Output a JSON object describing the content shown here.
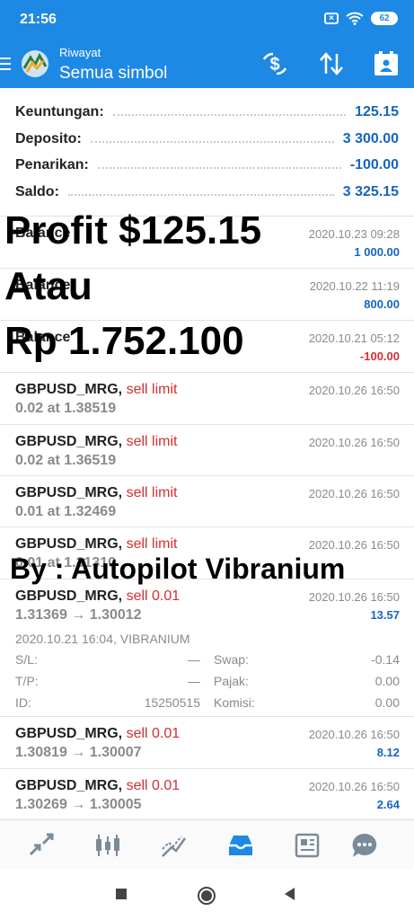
{
  "status_bar": {
    "time": "21:56",
    "close_badge": "×",
    "battery": "62"
  },
  "app_bar": {
    "subtitle": "Riwayat",
    "title": "Semua simbol"
  },
  "summary": [
    {
      "label": "Keuntungan:",
      "value": "125.15"
    },
    {
      "label": "Deposito:",
      "value": "3 300.00"
    },
    {
      "label": "Penarikan:",
      "value": "-100.00"
    },
    {
      "label": "Saldo:",
      "value": "3 325.15"
    }
  ],
  "balance_rows": [
    {
      "label": "Balance",
      "time": "2020.10.23 09:28",
      "amount": "1 000.00"
    },
    {
      "label": "Balance",
      "time": "2020.10.22 11:19",
      "amount": "800.00"
    },
    {
      "label": "Balance",
      "time": "2020.10.21 05:12",
      "amount": "-100.00"
    }
  ],
  "orders": [
    {
      "symbol": "GBPUSD_MRG,",
      "type": "sell limit",
      "detail": "0.02 at 1.38519",
      "time": "2020.10.26 16:50"
    },
    {
      "symbol": "GBPUSD_MRG,",
      "type": "sell limit",
      "detail": "0.02 at 1.36519",
      "time": "2020.10.26 16:50"
    },
    {
      "symbol": "GBPUSD_MRG,",
      "type": "sell limit",
      "detail": "0.01 at 1.32469",
      "time": "2020.10.26 16:50"
    },
    {
      "symbol": "GBPUSD_MRG,",
      "type": "sell limit",
      "detail": "0.01 at 1.31310",
      "time": "2020.10.26 16:50"
    }
  ],
  "expanded_deal": {
    "symbol": "GBPUSD_MRG,",
    "type": "sell 0.01",
    "prices": "1.31369 → 1.30012",
    "time": "2020.10.26 16:50",
    "profit": "13.57",
    "open_info": "2020.10.21 16:04, VIBRANIUM",
    "sl_label": "S/L:",
    "sl_value": "—",
    "tp_label": "T/P:",
    "tp_value": "—",
    "id_label": "ID:",
    "id_value": "15250515",
    "swap_label": "Swap:",
    "swap_value": "-0.14",
    "tax_label": "Pajak:",
    "tax_value": "0.00",
    "commission_label": "Komisi:",
    "commission_value": "0.00"
  },
  "deals": [
    {
      "symbol": "GBPUSD_MRG,",
      "type": "sell 0.01",
      "prices": "1.30819 → 1.30007",
      "time": "2020.10.26 16:50",
      "profit": "8.12"
    },
    {
      "symbol": "GBPUSD_MRG,",
      "type": "sell 0.01",
      "prices": "1.30269 → 1.30005",
      "time": "2020.10.26 16:50",
      "profit": "2.64"
    }
  ],
  "overlay_text": {
    "line1": "Profit $125.15",
    "line2": "Atau",
    "line3": "Rp 1.752.100",
    "credit": "By : Autopilot Vibranium"
  },
  "tabs": [
    "quotes-icon",
    "chart-icon",
    "trade-icon",
    "history-icon",
    "news-icon",
    "chat-icon"
  ],
  "colors": {
    "primary": "#1e88e5",
    "profit_blue": "#1565c0",
    "loss_red": "#d32f2f"
  }
}
